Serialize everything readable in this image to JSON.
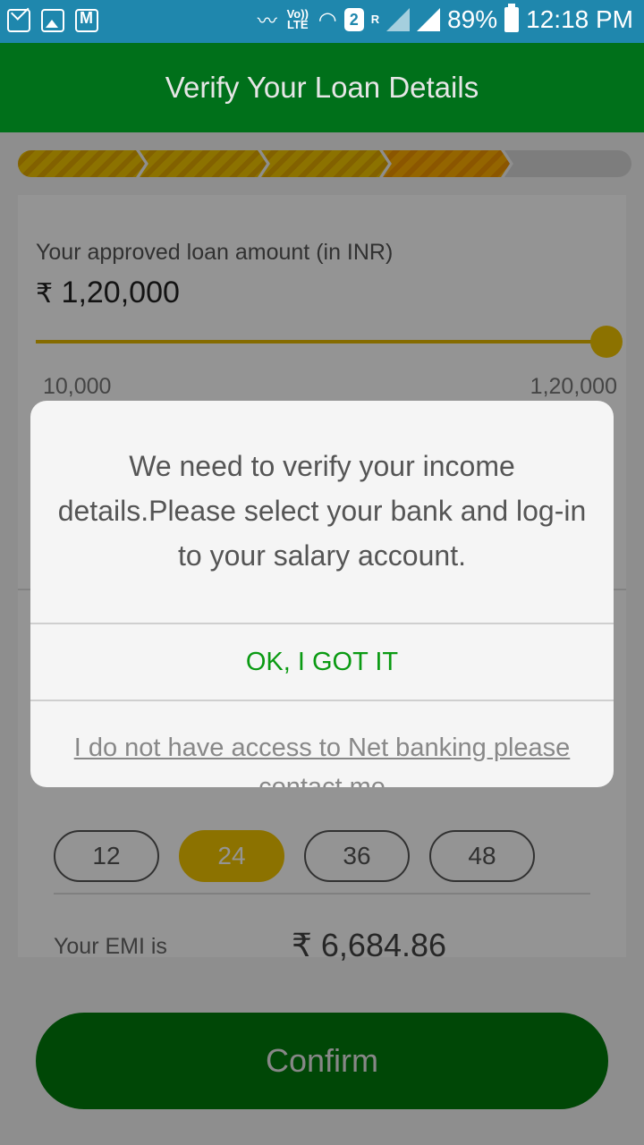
{
  "status_bar": {
    "icons": [
      "mail-icon",
      "image-icon",
      "gmail-icon",
      "vibrate-icon",
      "volte-icon",
      "wifi-icon",
      "sim-2-icon",
      "roaming-signal-icon",
      "signal-icon",
      "battery-icon"
    ],
    "volte_label": "Vo)) LTE",
    "sim_label": "2",
    "roaming_label": "R",
    "battery_percent": "89%",
    "time": "12:18 PM"
  },
  "header": {
    "title": "Verify Your Loan Details"
  },
  "progress": {
    "total_steps": 5,
    "completed_steps": 3,
    "current_step": 4
  },
  "loan": {
    "label": "Your approved loan amount (in INR)",
    "currency_symbol": "₹",
    "amount": "1,20,000",
    "slider_min": "10,000",
    "slider_max": "1,20,000",
    "slider_fraction": 1.0
  },
  "tenure": {
    "options": [
      "12",
      "24",
      "36",
      "48"
    ],
    "selected": "24"
  },
  "emi": {
    "label": "Your EMI is",
    "value": "₹ 6,684.86"
  },
  "confirm_button": {
    "label": "Confirm"
  },
  "dialog": {
    "message": "We need to verify your income details.Please select your bank and log-in to your salary account.",
    "ok_label": "OK, I GOT IT",
    "netbanking_link": "I do not have access to Net banking please contact me"
  },
  "colors": {
    "status_bar": "#1f87ad",
    "header": "#00701a",
    "accent_yellow": "#f2c400",
    "ok_green": "#0a9a12",
    "confirm_green": "#007a0c"
  }
}
